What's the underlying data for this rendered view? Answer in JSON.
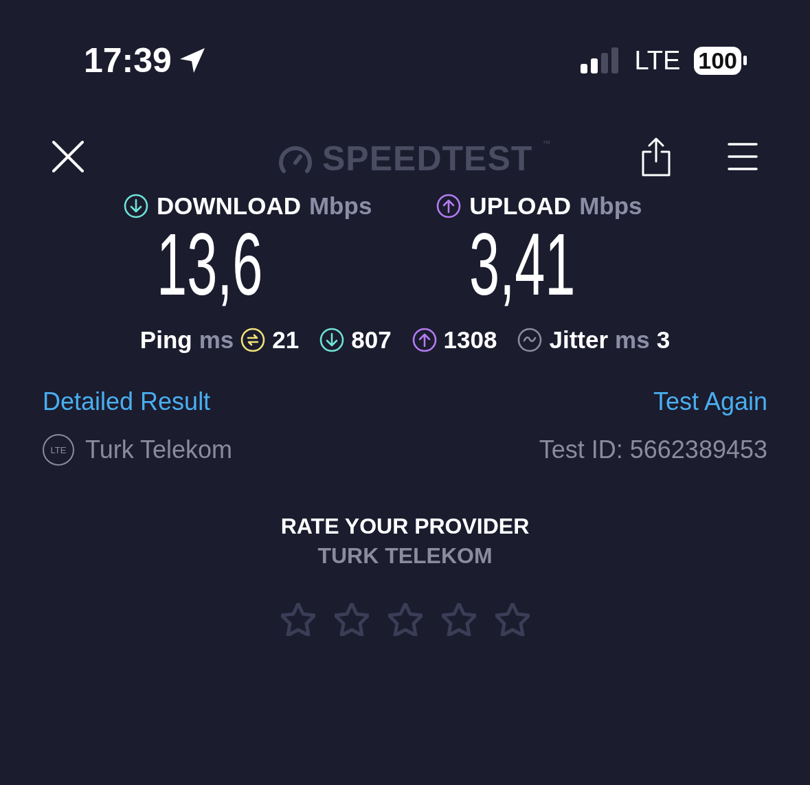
{
  "status_bar": {
    "time": "17:39",
    "network": "LTE",
    "battery": "100"
  },
  "header": {
    "logo": "SPEEDTEST",
    "trademark": "™"
  },
  "speeds": [
    {
      "kind": "download",
      "label": "DOWNLOAD",
      "unit": "Mbps",
      "value": "13,6"
    },
    {
      "kind": "upload",
      "label": "UPLOAD",
      "unit": "Mbps",
      "value": "3,41"
    }
  ],
  "metrics": [
    {
      "kind": "ping",
      "label": "Ping",
      "unit": "ms",
      "value": "21"
    },
    {
      "kind": "download",
      "value": "807"
    },
    {
      "kind": "upload",
      "value": "1308"
    },
    {
      "kind": "jitter",
      "label": "Jitter",
      "unit": "ms",
      "value": "3"
    }
  ],
  "links": {
    "detailed": "Detailed Result",
    "again": "Test Again"
  },
  "provider": {
    "badge": "LTE",
    "name": "Turk Telekom",
    "test_id": "Test ID: 5662389453"
  },
  "rating": {
    "title": "RATE YOUR PROVIDER",
    "provider": "TURK TELEKOM",
    "stars": 0
  }
}
